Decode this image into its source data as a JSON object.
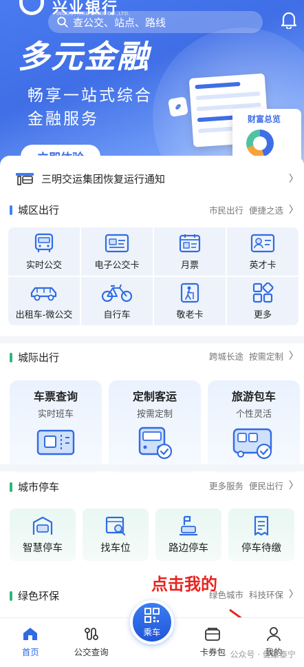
{
  "header": {
    "bank_name": "兴业银行",
    "bank_name_en": "INDUSTRIAL BANK CO.,LTD.",
    "search_placeholder": "查公交、站点、路线"
  },
  "banner": {
    "title": "多元金融",
    "subtitle_line1": "畅享一站式综合",
    "subtitle_line2": "金融服务",
    "cta": "立即体验",
    "card_label": "财富总览"
  },
  "notice": {
    "text": "三明交运集团恢复运行通知"
  },
  "city_travel": {
    "title": "城区出行",
    "links": [
      "市民出行",
      "便捷之选"
    ],
    "items": [
      {
        "label": "实时公交",
        "icon": "bus-icon"
      },
      {
        "label": "电子公交卡",
        "icon": "bus-card-icon"
      },
      {
        "label": "月票",
        "icon": "monthly-ticket-icon"
      },
      {
        "label": "英才卡",
        "icon": "talent-card-icon"
      },
      {
        "label": "出租车-微公交",
        "icon": "taxi-icon"
      },
      {
        "label": "自行车",
        "icon": "bicycle-icon"
      },
      {
        "label": "敬老卡",
        "icon": "elder-card-icon"
      },
      {
        "label": "更多",
        "icon": "more-icon"
      }
    ]
  },
  "intercity": {
    "title": "城际出行",
    "links": [
      "跨城长途",
      "按需定制"
    ],
    "cards": [
      {
        "title": "车票查询",
        "sub": "实时班车"
      },
      {
        "title": "定制客运",
        "sub": "按需定制"
      },
      {
        "title": "旅游包车",
        "sub": "个性灵活"
      }
    ]
  },
  "parking": {
    "title": "城市停车",
    "links": [
      "更多服务",
      "便民出行"
    ],
    "items": [
      "智慧停车",
      "找车位",
      "路边停车",
      "停车待缴"
    ]
  },
  "green": {
    "title": "绿色环保",
    "links": [
      "绿色城市",
      "科技环保"
    ]
  },
  "annotation": "点击我的",
  "tabbar": {
    "items": [
      "首页",
      "公交查询",
      "乘车",
      "卡券包",
      "我的"
    ]
  },
  "watermark": "公众号 · 健康泰宁",
  "colors": {
    "accent": "#2f6be3",
    "annotation": "#e8231f",
    "green": "#2fb67c"
  }
}
